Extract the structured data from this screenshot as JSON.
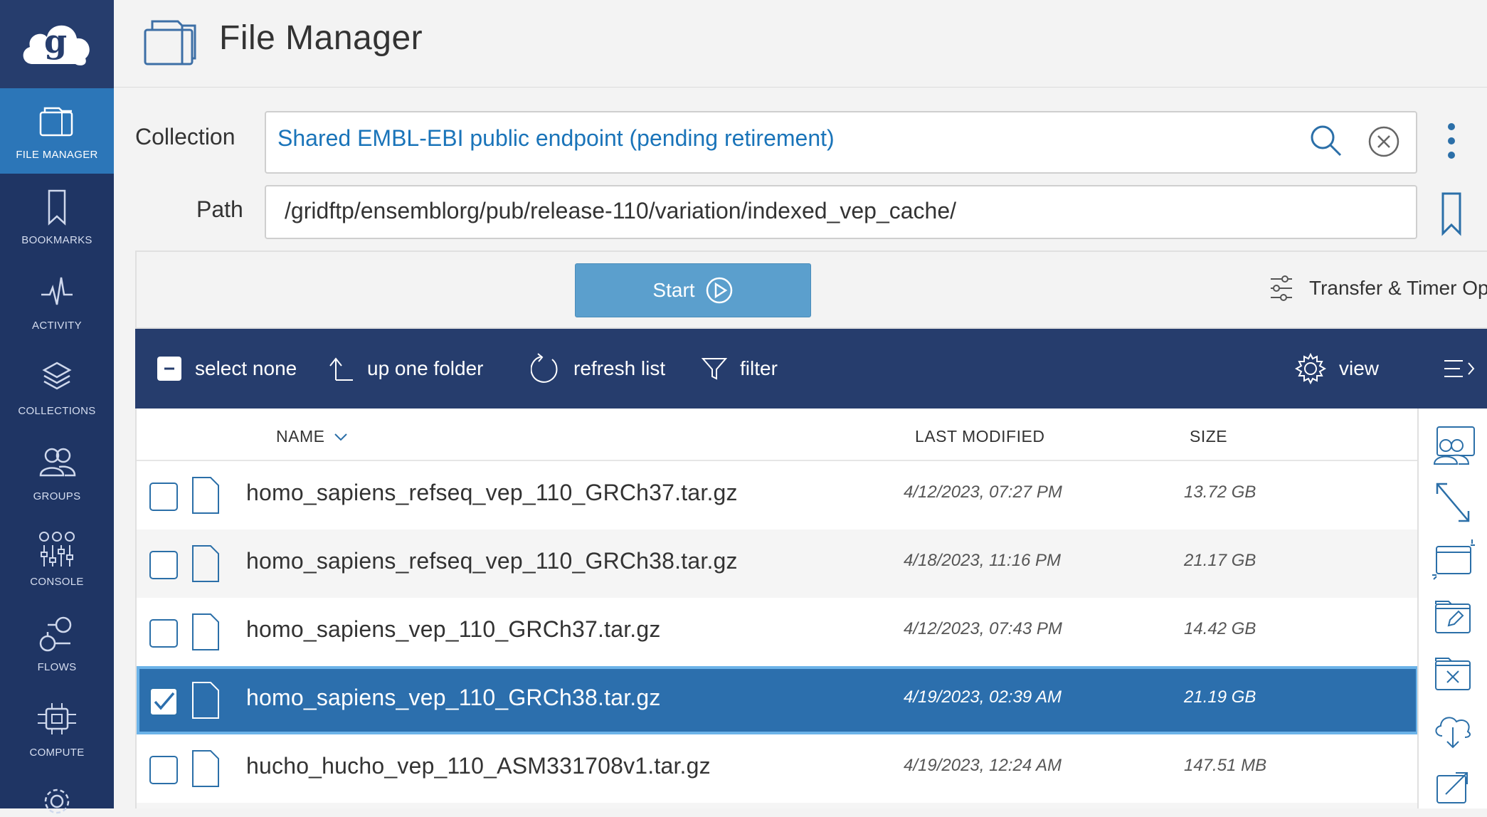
{
  "app": {
    "title": "File Manager"
  },
  "sidebar": {
    "items": [
      {
        "label": "FILE MANAGER",
        "icon": "file-manager-icon",
        "active": true
      },
      {
        "label": "BOOKMARKS",
        "icon": "bookmark-icon"
      },
      {
        "label": "ACTIVITY",
        "icon": "activity-icon"
      },
      {
        "label": "COLLECTIONS",
        "icon": "layers-icon"
      },
      {
        "label": "GROUPS",
        "icon": "groups-icon"
      },
      {
        "label": "CONSOLE",
        "icon": "console-icon"
      },
      {
        "label": "FLOWS",
        "icon": "flows-icon"
      },
      {
        "label": "COMPUTE",
        "icon": "compute-icon"
      }
    ]
  },
  "collection": {
    "label": "Collection",
    "value": "Shared EMBL-EBI public endpoint (pending retirement)"
  },
  "path": {
    "label": "Path",
    "value": "/gridftp/ensemblorg/pub/release-110/variation/indexed_vep_cache/"
  },
  "transfer": {
    "start_label": "Start",
    "options_label": "Transfer & Timer Op"
  },
  "toolbar": {
    "select_none": "select none",
    "up_one_folder": "up one folder",
    "refresh_list": "refresh list",
    "filter": "filter",
    "view": "view"
  },
  "table": {
    "columns": {
      "name": "NAME",
      "modified": "LAST MODIFIED",
      "size": "SIZE"
    },
    "rows": [
      {
        "name": "homo_sapiens_refseq_vep_110_GRCh37.tar.gz",
        "modified": "4/12/2023, 07:27 PM",
        "size": "13.72 GB",
        "selected": false
      },
      {
        "name": "homo_sapiens_refseq_vep_110_GRCh38.tar.gz",
        "modified": "4/18/2023, 11:16 PM",
        "size": "21.17 GB",
        "selected": false
      },
      {
        "name": "homo_sapiens_vep_110_GRCh37.tar.gz",
        "modified": "4/12/2023, 07:43 PM",
        "size": "14.42 GB",
        "selected": false
      },
      {
        "name": "homo_sapiens_vep_110_GRCh38.tar.gz",
        "modified": "4/19/2023, 02:39 AM",
        "size": "21.19 GB",
        "selected": true
      },
      {
        "name": "hucho_hucho_vep_110_ASM331708v1.tar.gz",
        "modified": "4/19/2023, 12:24 AM",
        "size": "147.51 MB",
        "selected": false
      }
    ]
  },
  "colors": {
    "sidebar_bg": "#1f3564",
    "sidebar_active": "#2c76b8",
    "toolbar_bg": "#263d6d",
    "link_blue": "#1a74b9",
    "start_button": "#5b9fcd",
    "selected_row": "#2c6fad"
  }
}
